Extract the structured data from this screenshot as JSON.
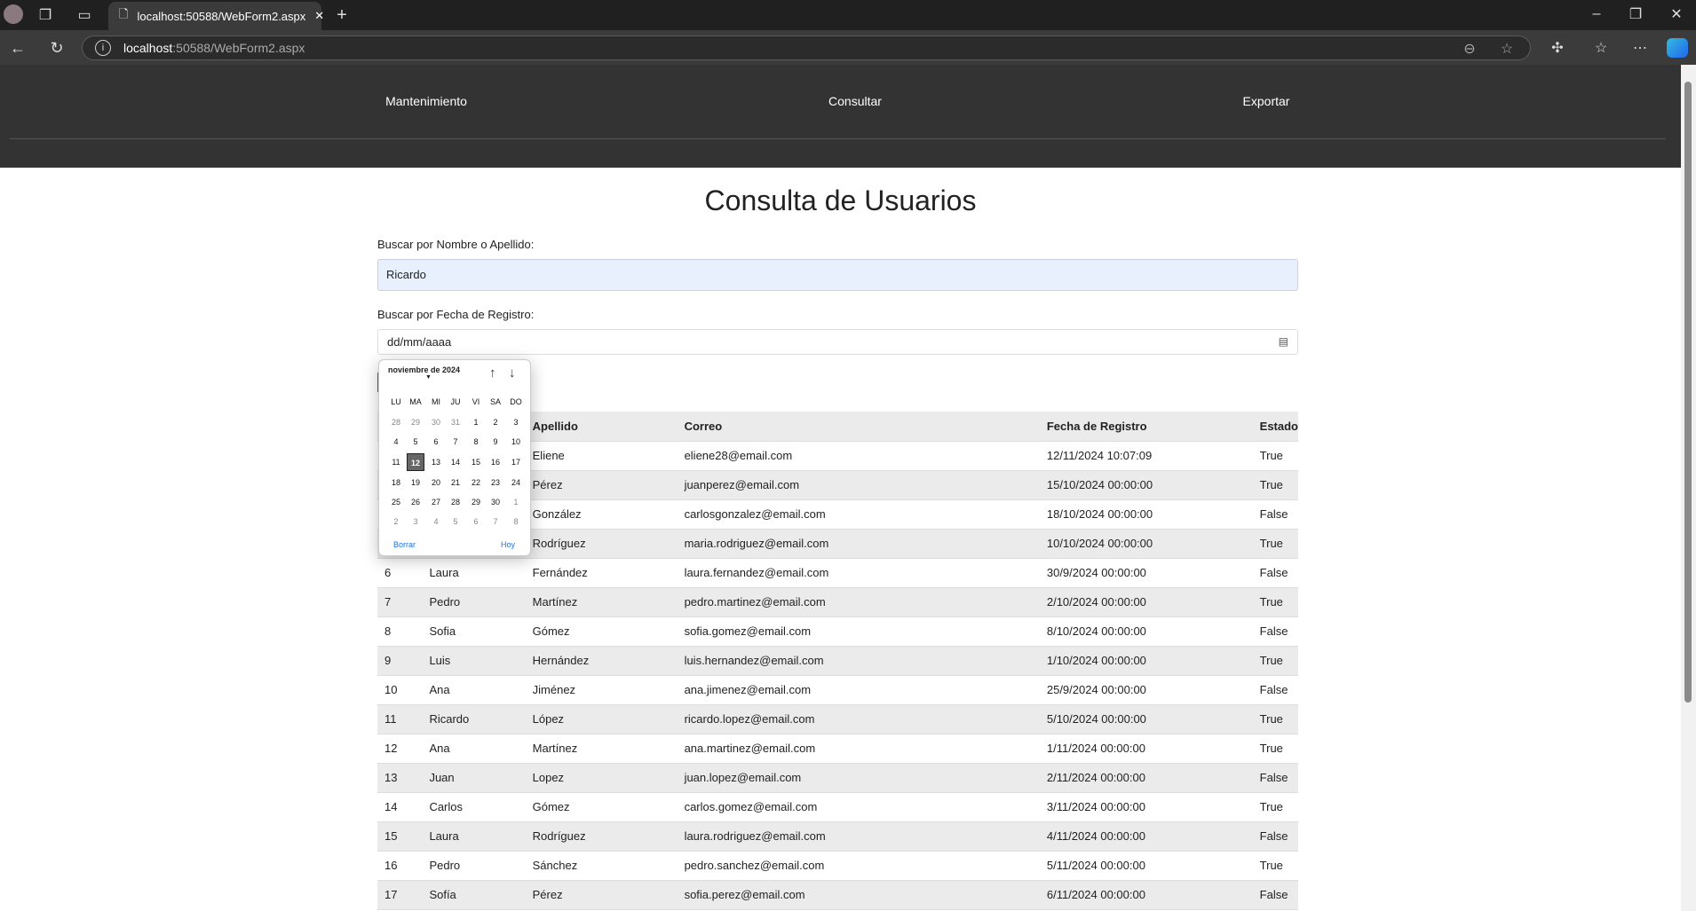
{
  "browser": {
    "tab_title": "localhost:50588/WebForm2.aspx",
    "url_host": "localhost",
    "url_rest": ":50588/WebForm2.aspx"
  },
  "nav": {
    "items": [
      "Mantenimiento",
      "Consultar",
      "Exportar"
    ]
  },
  "page": {
    "title": "Consulta de Usuarios",
    "search_label": "Buscar por Nombre o Apellido:",
    "search_value": "Ricardo",
    "date_label": "Buscar por Fecha de Registro:",
    "date_placeholder": "dd/mm/aaaa"
  },
  "calendar": {
    "month_label": "noviembre de 2024",
    "weekdays": [
      "LU",
      "MA",
      "MI",
      "JU",
      "VI",
      "SA",
      "DO"
    ],
    "weeks": [
      [
        "28",
        "29",
        "30",
        "31",
        "1",
        "2",
        "3"
      ],
      [
        "4",
        "5",
        "6",
        "7",
        "8",
        "9",
        "10"
      ],
      [
        "11",
        "12",
        "13",
        "14",
        "15",
        "16",
        "17"
      ],
      [
        "18",
        "19",
        "20",
        "21",
        "22",
        "23",
        "24"
      ],
      [
        "25",
        "26",
        "27",
        "28",
        "29",
        "30",
        "1"
      ],
      [
        "2",
        "3",
        "4",
        "5",
        "6",
        "7",
        "8"
      ]
    ],
    "selected": "12",
    "clear_label": "Borrar",
    "today_label": "Hoy"
  },
  "table": {
    "headers": [
      "",
      "",
      "Apellido",
      "Correo",
      "Fecha de Registro",
      "Estado"
    ],
    "rows": [
      [
        "",
        "",
        "Eliene",
        "eliene28@email.com",
        "12/11/2024 10:07:09",
        "True"
      ],
      [
        "",
        "",
        "Pérez",
        "juanperez@email.com",
        "15/10/2024 00:00:00",
        "True"
      ],
      [
        "",
        "",
        "González",
        "carlosgonzalez@email.com",
        "18/10/2024 00:00:00",
        "False"
      ],
      [
        "",
        "",
        "Rodríguez",
        "maria.rodriguez@email.com",
        "10/10/2024 00:00:00",
        "True"
      ],
      [
        "6",
        "Laura",
        "Fernández",
        "laura.fernandez@email.com",
        "30/9/2024 00:00:00",
        "False"
      ],
      [
        "7",
        "Pedro",
        "Martínez",
        "pedro.martinez@email.com",
        "2/10/2024 00:00:00",
        "True"
      ],
      [
        "8",
        "Sofia",
        "Gómez",
        "sofia.gomez@email.com",
        "8/10/2024 00:00:00",
        "False"
      ],
      [
        "9",
        "Luis",
        "Hernández",
        "luis.hernandez@email.com",
        "1/10/2024 00:00:00",
        "True"
      ],
      [
        "10",
        "Ana",
        "Jiménez",
        "ana.jimenez@email.com",
        "25/9/2024 00:00:00",
        "False"
      ],
      [
        "11",
        "Ricardo",
        "López",
        "ricardo.lopez@email.com",
        "5/10/2024 00:00:00",
        "True"
      ],
      [
        "12",
        "Ana",
        "Martínez",
        "ana.martinez@email.com",
        "1/11/2024 00:00:00",
        "True"
      ],
      [
        "13",
        "Juan",
        "Lopez",
        "juan.lopez@email.com",
        "2/11/2024 00:00:00",
        "False"
      ],
      [
        "14",
        "Carlos",
        "Gómez",
        "carlos.gomez@email.com",
        "3/11/2024 00:00:00",
        "True"
      ],
      [
        "15",
        "Laura",
        "Rodríguez",
        "laura.rodriguez@email.com",
        "4/11/2024 00:00:00",
        "False"
      ],
      [
        "16",
        "Pedro",
        "Sánchez",
        "pedro.sanchez@email.com",
        "5/11/2024 00:00:00",
        "True"
      ],
      [
        "17",
        "Sofía",
        "Pérez",
        "sofia.perez@email.com",
        "6/11/2024 00:00:00",
        "False"
      ]
    ]
  }
}
